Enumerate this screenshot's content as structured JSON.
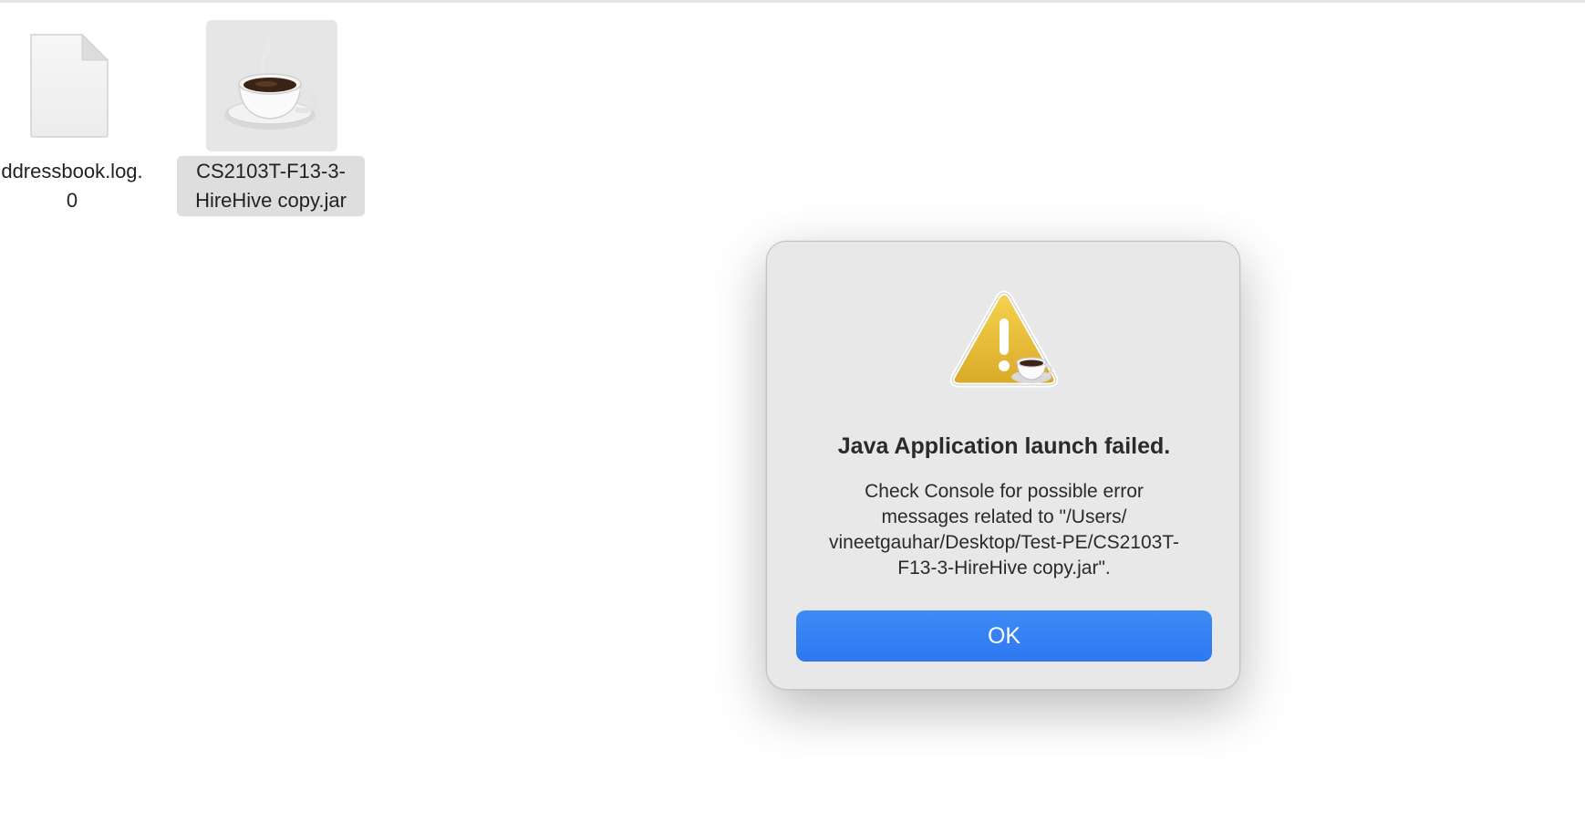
{
  "desktop": {
    "files": [
      {
        "name_line1": "ddressbook.log.",
        "name_line2": "0",
        "icon": "document-file-icon"
      },
      {
        "name_line1": "CS2103T-F13-3-",
        "name_line2": "HireHive copy.jar",
        "icon": "java-coffee-cup-icon",
        "selected": true
      }
    ]
  },
  "dialog": {
    "icon": "java-warning-icon",
    "title": "Java Application launch failed.",
    "message": "Check Console for possible error\nmessages related to \"/Users/\nvineetgauhar/Desktop/Test-PE/CS2103T-\nF13-3-HireHive copy.jar\".",
    "ok_label": "OK",
    "accent_color": "#3480f3"
  }
}
